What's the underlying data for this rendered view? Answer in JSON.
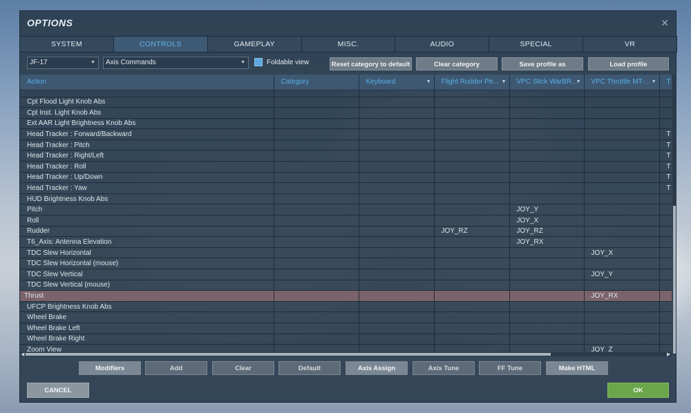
{
  "window": {
    "title": "OPTIONS"
  },
  "tabs": [
    {
      "label": "SYSTEM"
    },
    {
      "label": "CONTROLS"
    },
    {
      "label": "GAMEPLAY"
    },
    {
      "label": "MISC."
    },
    {
      "label": "AUDIO"
    },
    {
      "label": "SPECIAL"
    },
    {
      "label": "VR"
    }
  ],
  "active_tab": "CONTROLS",
  "toolbar": {
    "aircraft_select": "JF-17",
    "category_select": "Axis Commands",
    "foldable_view_label": "Foldable view",
    "foldable_view_checked": true,
    "reset_category_label": "Reset category to default",
    "clear_category_label": "Clear category",
    "save_profile_label": "Save profile as",
    "load_profile_label": "Load profile"
  },
  "grid": {
    "headers": [
      "Action",
      "Category",
      "Keyboard",
      "Flight Rudder Pe...",
      "VPC Stick WarBR...",
      "VPC Throttle MT-...",
      "T"
    ],
    "partial_top_row": "",
    "rows": [
      {
        "action": "Cpt Flood Light Knob Abs",
        "category": "",
        "keyboard": "",
        "rudder": "",
        "stick": "",
        "throttle": "",
        "trackir": ""
      },
      {
        "action": "Cpt Inst. Light Knob Abs",
        "category": "",
        "keyboard": "",
        "rudder": "",
        "stick": "",
        "throttle": "",
        "trackir": ""
      },
      {
        "action": "Ext AAR Light Brightness Knob Abs",
        "category": "",
        "keyboard": "",
        "rudder": "",
        "stick": "",
        "throttle": "",
        "trackir": ""
      },
      {
        "action": "Head Tracker : Forward/Backward",
        "category": "",
        "keyboard": "",
        "rudder": "",
        "stick": "",
        "throttle": "",
        "trackir": "T"
      },
      {
        "action": "Head Tracker : Pitch",
        "category": "",
        "keyboard": "",
        "rudder": "",
        "stick": "",
        "throttle": "",
        "trackir": "T"
      },
      {
        "action": "Head Tracker : Right/Left",
        "category": "",
        "keyboard": "",
        "rudder": "",
        "stick": "",
        "throttle": "",
        "trackir": "T"
      },
      {
        "action": "Head Tracker : Roll",
        "category": "",
        "keyboard": "",
        "rudder": "",
        "stick": "",
        "throttle": "",
        "trackir": "T"
      },
      {
        "action": "Head Tracker : Up/Down",
        "category": "",
        "keyboard": "",
        "rudder": "",
        "stick": "",
        "throttle": "",
        "trackir": "T"
      },
      {
        "action": "Head Tracker : Yaw",
        "category": "",
        "keyboard": "",
        "rudder": "",
        "stick": "",
        "throttle": "",
        "trackir": "T"
      },
      {
        "action": "HUD Brightness Knob Abs",
        "category": "",
        "keyboard": "",
        "rudder": "",
        "stick": "",
        "throttle": "",
        "trackir": ""
      },
      {
        "action": "Pitch",
        "category": "",
        "keyboard": "",
        "rudder": "",
        "stick": "JOY_Y",
        "throttle": "",
        "trackir": ""
      },
      {
        "action": "Roll",
        "category": "",
        "keyboard": "",
        "rudder": "",
        "stick": "JOY_X",
        "throttle": "",
        "trackir": ""
      },
      {
        "action": "Rudder",
        "category": "",
        "keyboard": "",
        "rudder": "JOY_RZ",
        "stick": "JOY_RZ",
        "throttle": "",
        "trackir": ""
      },
      {
        "action": "T6_Axis: Antenna Elevation",
        "category": "",
        "keyboard": "",
        "rudder": "",
        "stick": "JOY_RX",
        "throttle": "",
        "trackir": ""
      },
      {
        "action": "TDC Slew Horizontal",
        "category": "",
        "keyboard": "",
        "rudder": "",
        "stick": "",
        "throttle": "JOY_X",
        "trackir": ""
      },
      {
        "action": "TDC Slew Horizontal (mouse)",
        "category": "",
        "keyboard": "",
        "rudder": "",
        "stick": "",
        "throttle": "",
        "trackir": ""
      },
      {
        "action": "TDC Slew Vertical",
        "category": "",
        "keyboard": "",
        "rudder": "",
        "stick": "",
        "throttle": "JOY_Y",
        "trackir": ""
      },
      {
        "action": "TDC Slew Vertical (mouse)",
        "category": "",
        "keyboard": "",
        "rudder": "",
        "stick": "",
        "throttle": "",
        "trackir": ""
      },
      {
        "action": "Thrust",
        "category": "",
        "keyboard": "",
        "rudder": "",
        "stick": "",
        "throttle": "JOY_RX",
        "trackir": "",
        "selected": true
      },
      {
        "action": "UFCP Brightness Knob Abs",
        "category": "",
        "keyboard": "",
        "rudder": "",
        "stick": "",
        "throttle": "",
        "trackir": ""
      },
      {
        "action": "Wheel Brake",
        "category": "",
        "keyboard": "",
        "rudder": "",
        "stick": "",
        "throttle": "",
        "trackir": ""
      },
      {
        "action": "Wheel Brake Left",
        "category": "",
        "keyboard": "",
        "rudder": "",
        "stick": "",
        "throttle": "",
        "trackir": ""
      },
      {
        "action": "Wheel Brake Right",
        "category": "",
        "keyboard": "",
        "rudder": "",
        "stick": "",
        "throttle": "",
        "trackir": ""
      },
      {
        "action": "Zoom View",
        "category": "",
        "keyboard": "",
        "rudder": "",
        "stick": "",
        "throttle": "JOY_Z",
        "trackir": ""
      }
    ]
  },
  "bottom_buttons": [
    {
      "label": "Modifiers",
      "enabled": true
    },
    {
      "label": "Add",
      "enabled": false
    },
    {
      "label": "Clear",
      "enabled": false
    },
    {
      "label": "Default",
      "enabled": false
    },
    {
      "label": "Axis Assign",
      "enabled": true
    },
    {
      "label": "Axis Tune",
      "enabled": false
    },
    {
      "label": "FF Tune",
      "enabled": false
    },
    {
      "label": "Make HTML",
      "enabled": true
    }
  ],
  "footer": {
    "cancel_label": "CANCEL",
    "ok_label": "OK"
  },
  "icons": {
    "close": "close-icon",
    "dropdown": "chevron-down-icon",
    "checkbox": "checkbox-icon"
  },
  "colors": {
    "accent": "#5fb3e6",
    "ok": "#6aa64a",
    "selected_row": "#9a6e73"
  }
}
